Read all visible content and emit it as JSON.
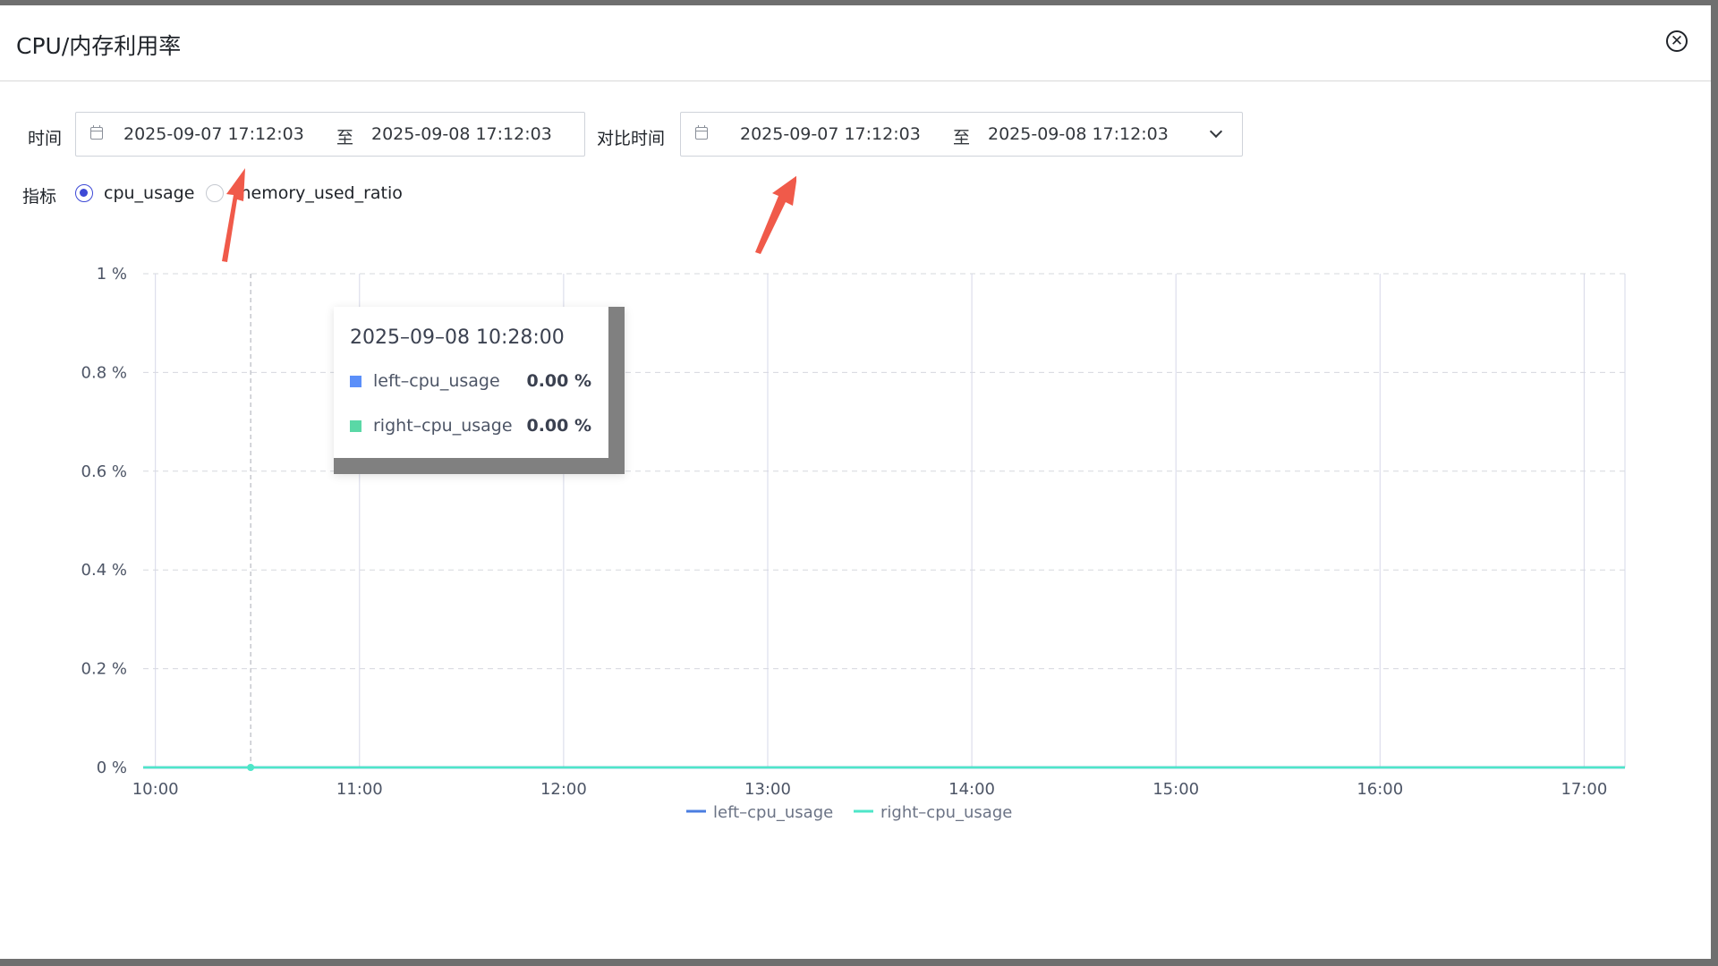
{
  "dialog": {
    "title": "CPU/内存利用率",
    "close_icon": "close-circle-icon"
  },
  "filters": {
    "time_label": "时间",
    "time_range": {
      "start": "2025-09-07 17:12:03",
      "separator": "至",
      "end": "2025-09-08 17:12:03"
    },
    "compare_label": "对比时间",
    "compare_range": {
      "start": "2025-09-07 17:12:03",
      "separator": "至",
      "end": "2025-09-08 17:12:03"
    },
    "metric_label": "指标",
    "metrics": [
      {
        "label": "cpu_usage",
        "checked": true
      },
      {
        "label": "memory_used_ratio",
        "checked": false
      }
    ]
  },
  "annotations": {
    "arrow_color": "#f05a4a"
  },
  "tooltip": {
    "title": "2025–09–08 10:28:00",
    "rows": [
      {
        "name": "left–cpu_usage",
        "value": "0.00 %",
        "color": "#5b8ff9"
      },
      {
        "name": "right–cpu_usage",
        "value": "0.00 %",
        "color": "#5ad8a6"
      }
    ]
  },
  "chart_data": {
    "type": "line",
    "title": "",
    "xlabel": "",
    "ylabel": "",
    "x_ticks": [
      "10:00",
      "11:00",
      "12:00",
      "13:00",
      "14:00",
      "15:00",
      "16:00",
      "17:00"
    ],
    "y_ticks": [
      "0 %",
      "0.2 %",
      "0.4 %",
      "0.6 %",
      "0.8 %",
      "1 %"
    ],
    "ylim": [
      0,
      1
    ],
    "x_range_hours": [
      9.94,
      17.2
    ],
    "hover_x_hour": 10.4667,
    "grid": true,
    "legend_position": "bottom-center",
    "series": [
      {
        "name": "left–cpu_usage",
        "color": "#4a7de0",
        "x": [
          9.94,
          17.2
        ],
        "y": [
          0,
          0
        ]
      },
      {
        "name": "right–cpu_usage",
        "color": "#4ee6c8",
        "x": [
          9.94,
          17.2
        ],
        "y": [
          0,
          0
        ]
      }
    ]
  }
}
